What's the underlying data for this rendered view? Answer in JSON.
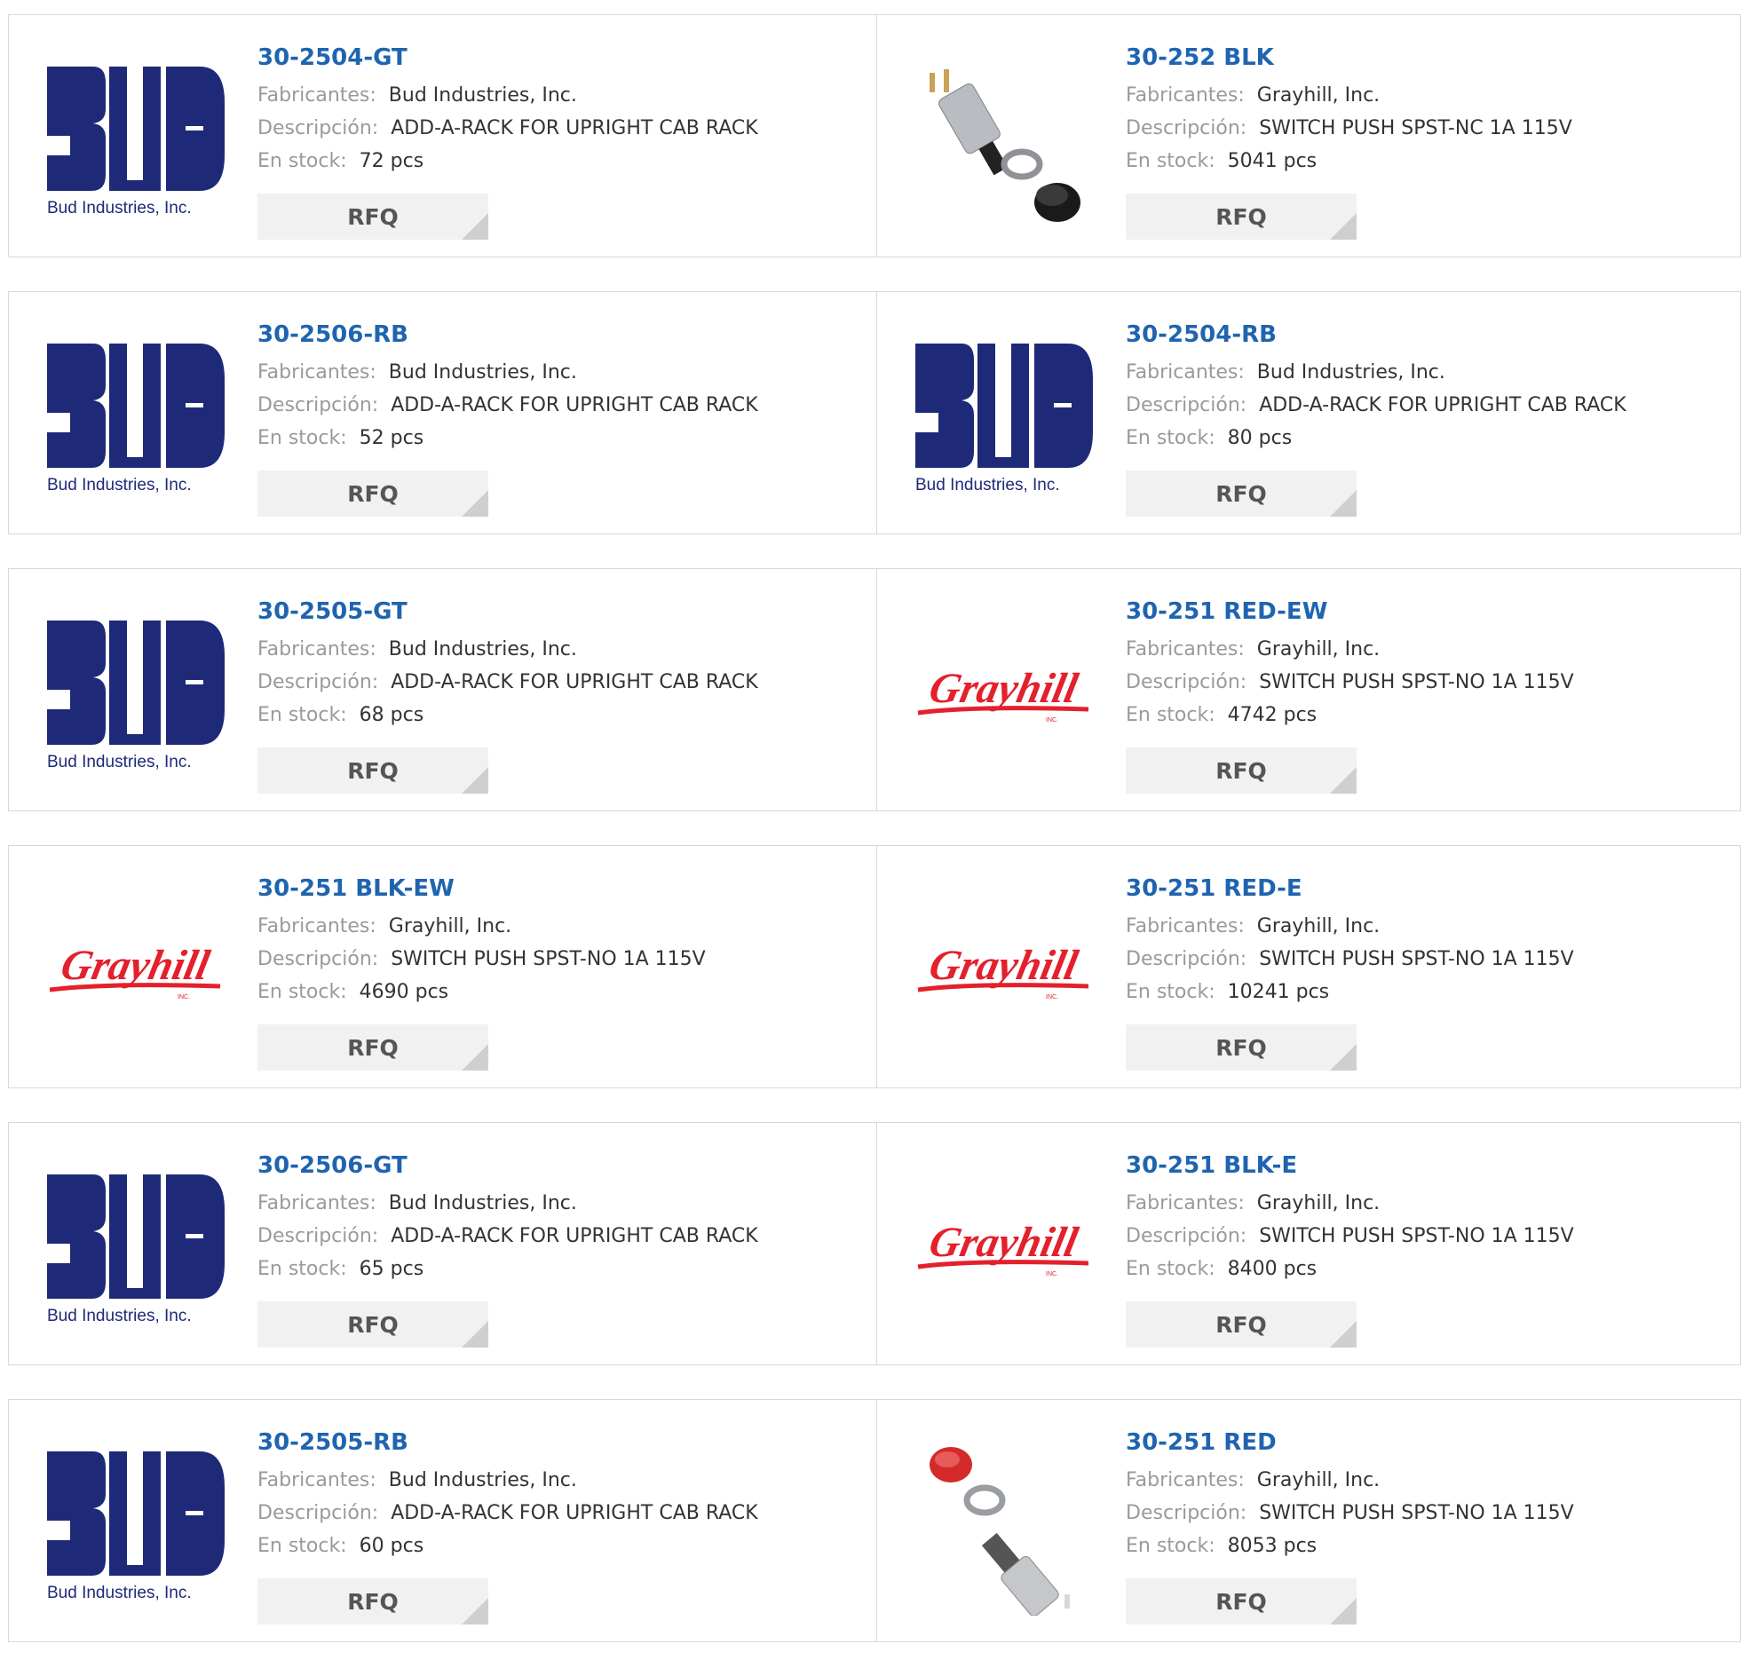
{
  "labels": {
    "manufacturer": "Fabricantes:",
    "description": "Descripción:",
    "stock": "En stock:",
    "rfq": "RFQ"
  },
  "logos": {
    "bud_text": "Bud Industries, Inc.",
    "grayhill_text": "Grayhill",
    "grayhill_inc": "INC."
  },
  "colors": {
    "part_link": "#1f64b0",
    "bud_logo": "#1e2a78",
    "grayhill_logo": "#e3202c",
    "rfq_bg": "#f1f1f1"
  },
  "products": [
    {
      "part": "30-2504-GT",
      "manufacturer": "Bud Industries, Inc.",
      "description": "ADD-A-RACK FOR UPRIGHT CAB RACK",
      "stock": "72 pcs",
      "image": "bud-logo"
    },
    {
      "part": "30-252 BLK",
      "manufacturer": "Grayhill, Inc.",
      "description": "SWITCH PUSH SPST-NC 1A 115V",
      "stock": "5041 pcs",
      "image": "switch-black-photo"
    },
    {
      "part": "30-2506-RB",
      "manufacturer": "Bud Industries, Inc.",
      "description": "ADD-A-RACK FOR UPRIGHT CAB RACK",
      "stock": "52 pcs",
      "image": "bud-logo"
    },
    {
      "part": "30-2504-RB",
      "manufacturer": "Bud Industries, Inc.",
      "description": "ADD-A-RACK FOR UPRIGHT CAB RACK",
      "stock": "80 pcs",
      "image": "bud-logo"
    },
    {
      "part": "30-2505-GT",
      "manufacturer": "Bud Industries, Inc.",
      "description": "ADD-A-RACK FOR UPRIGHT CAB RACK",
      "stock": "68 pcs",
      "image": "bud-logo"
    },
    {
      "part": "30-251 RED-EW",
      "manufacturer": "Grayhill, Inc.",
      "description": "SWITCH PUSH SPST-NO 1A 115V",
      "stock": "4742 pcs",
      "image": "grayhill-logo"
    },
    {
      "part": "30-251 BLK-EW",
      "manufacturer": "Grayhill, Inc.",
      "description": "SWITCH PUSH SPST-NO 1A 115V",
      "stock": "4690 pcs",
      "image": "grayhill-logo"
    },
    {
      "part": "30-251 RED-E",
      "manufacturer": "Grayhill, Inc.",
      "description": "SWITCH PUSH SPST-NO 1A 115V",
      "stock": "10241 pcs",
      "image": "grayhill-logo"
    },
    {
      "part": "30-2506-GT",
      "manufacturer": "Bud Industries, Inc.",
      "description": "ADD-A-RACK FOR UPRIGHT CAB RACK",
      "stock": "65 pcs",
      "image": "bud-logo"
    },
    {
      "part": "30-251 BLK-E",
      "manufacturer": "Grayhill, Inc.",
      "description": "SWITCH PUSH SPST-NO 1A 115V",
      "stock": "8400 pcs",
      "image": "grayhill-logo"
    },
    {
      "part": "30-2505-RB",
      "manufacturer": "Bud Industries, Inc.",
      "description": "ADD-A-RACK FOR UPRIGHT CAB RACK",
      "stock": "60 pcs",
      "image": "bud-logo"
    },
    {
      "part": "30-251 RED",
      "manufacturer": "Grayhill, Inc.",
      "description": "SWITCH PUSH SPST-NO 1A 115V",
      "stock": "8053 pcs",
      "image": "switch-red-photo"
    }
  ]
}
